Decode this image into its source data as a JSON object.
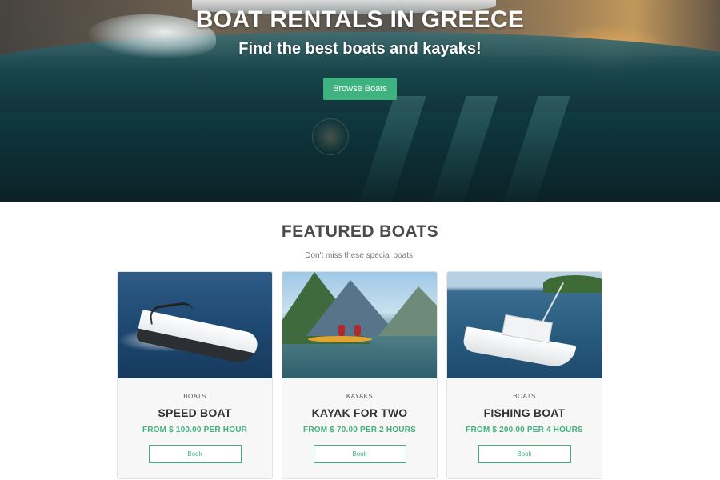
{
  "hero": {
    "title": "BOAT RENTALS IN GREECE",
    "subtitle": "Find the best boats and kayaks!",
    "cta_label": "Browse Boats"
  },
  "featured": {
    "title": "FEATURED BOATS",
    "subtitle": "Don't miss these special boats!",
    "cards": [
      {
        "category": "BOATS",
        "name": "SPEED BOAT",
        "price": "FROM $ 100.00 PER HOUR",
        "button": "Book",
        "image": "speed-boat-photo"
      },
      {
        "category": "KAYAKS",
        "name": "KAYAK FOR TWO",
        "price": "FROM $ 70.00 PER 2 HOURS",
        "button": "Book",
        "image": "kayak-photo"
      },
      {
        "category": "BOATS",
        "name": "FISHING BOAT",
        "price": "FROM $ 200.00 PER 4 HOURS",
        "button": "Book",
        "image": "fishing-boat-photo"
      }
    ]
  },
  "colors": {
    "accent": "#3fb37f",
    "heading": "#4a4a4a",
    "card_bg": "#f7f7f7"
  }
}
